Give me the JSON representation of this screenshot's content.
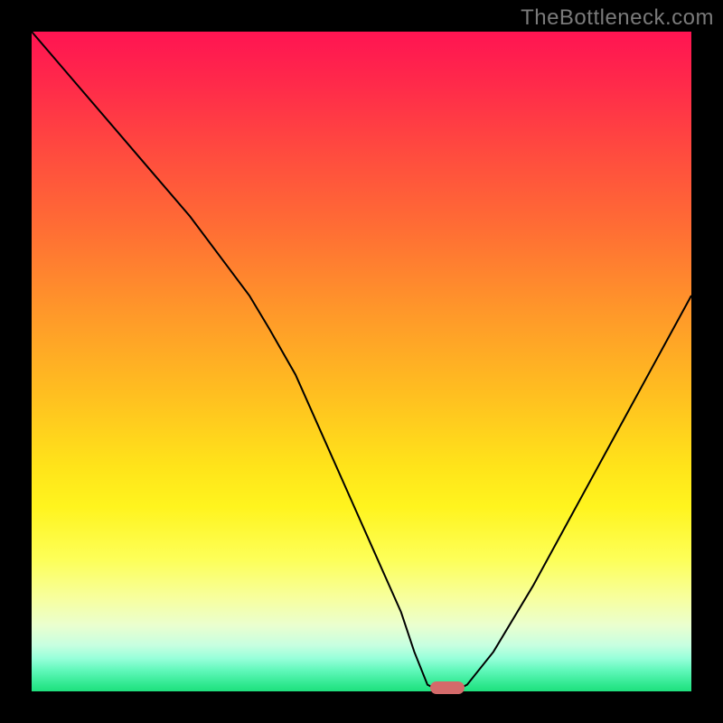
{
  "watermark": "TheBottleneck.com",
  "chart_data": {
    "type": "line",
    "title": "",
    "xlabel": "",
    "ylabel": "",
    "xlim": [
      0,
      100
    ],
    "ylim": [
      0,
      100
    ],
    "grid": false,
    "legend": false,
    "background": "rainbow-vertical-gradient",
    "series": [
      {
        "name": "bottleneck-curve",
        "x": [
          0,
          6,
          12,
          18,
          24,
          30,
          33,
          36,
          40,
          44,
          48,
          52,
          56,
          58,
          60,
          62,
          64,
          66,
          70,
          76,
          82,
          88,
          94,
          100
        ],
        "y": [
          100,
          93,
          86,
          79,
          72,
          64,
          60,
          55,
          48,
          39,
          30,
          21,
          12,
          6,
          1,
          0,
          0,
          1,
          6,
          16,
          27,
          38,
          49,
          60
        ]
      }
    ],
    "marker": {
      "name": "optimal-point",
      "x_percent": 63,
      "y_percent": 0,
      "color": "#d46a6a"
    }
  },
  "colors": {
    "frame": "#000000",
    "curve": "#000000",
    "watermark": "#7a7a7a"
  }
}
